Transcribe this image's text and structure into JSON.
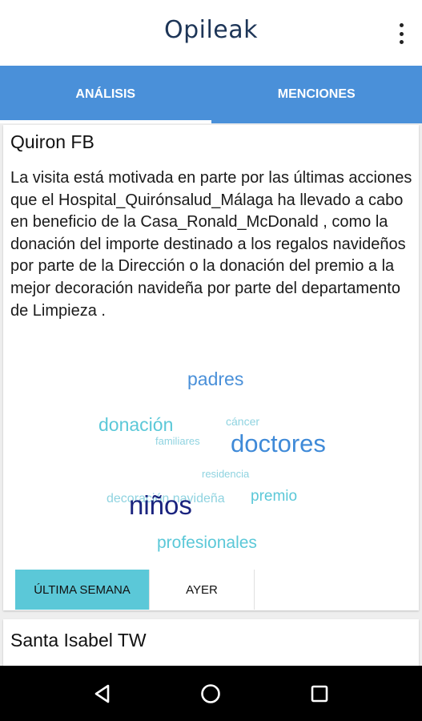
{
  "app": {
    "logo_text": "Opileak",
    "menu_icon": "more-vert-icon"
  },
  "tabs": [
    {
      "label": "ANÁLISIS",
      "active": true
    },
    {
      "label": "MENCIONES",
      "active": false
    }
  ],
  "colors": {
    "primary": "#4a90d9",
    "active_filter": "#5bc8d8",
    "logo": "#1d3557"
  },
  "cards": [
    {
      "title": "Quiron FB",
      "body": "La visita está motivada en parte por las últimas acciones que el Hospital_Quirónsalud_Málaga ha llevado a cabo en beneficio de la Casa_Ronald_McDonald , como la donación del importe destinado a los regalos navideños por parte de la Dirección o la donación del premio a la mejor decoración navideña por parte del departamento de Limpieza .",
      "word_cloud": [
        {
          "text": "padres",
          "color": "#4a90d9"
        },
        {
          "text": "donación",
          "color": "#5bc8d8"
        },
        {
          "text": "cáncer",
          "color": "#8fd3e0"
        },
        {
          "text": "familiares",
          "color": "#8fd3e0"
        },
        {
          "text": "doctores",
          "color": "#3f8ad8"
        },
        {
          "text": "residencia",
          "color": "#8fd3e0"
        },
        {
          "text": "decoración navideña",
          "color": "#8fd3e0"
        },
        {
          "text": "niños",
          "color": "#1a237e"
        },
        {
          "text": "premio",
          "color": "#5bc8d8"
        },
        {
          "text": "profesionales",
          "color": "#5bc8d8"
        }
      ],
      "filters": [
        {
          "label": "ÚLTIMA SEMANA",
          "active": true
        },
        {
          "label": "AYER",
          "active": false
        }
      ]
    },
    {
      "title": "Santa Isabel TW"
    }
  ],
  "nav": {
    "back": "back-triangle-icon",
    "home": "home-circle-icon",
    "recents": "recents-square-icon"
  }
}
